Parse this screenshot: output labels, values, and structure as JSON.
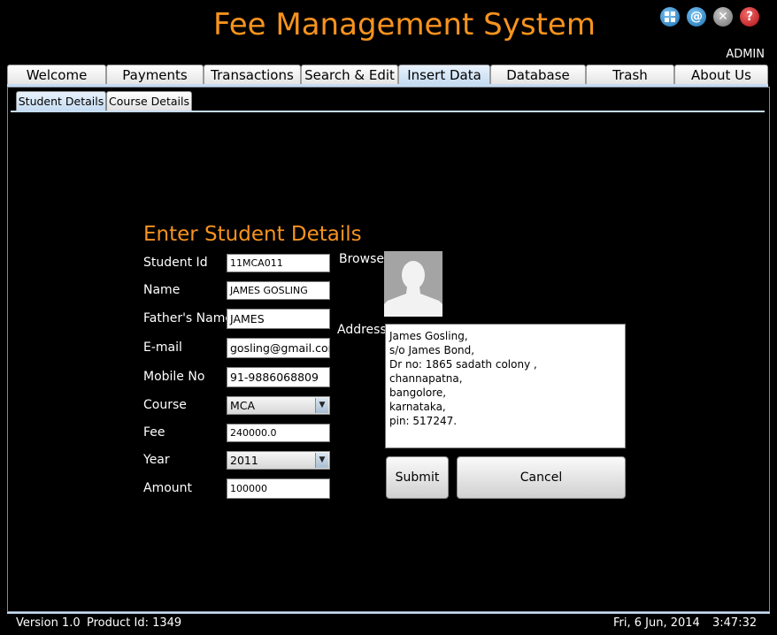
{
  "app": {
    "title": "Fee Management System",
    "user": "ADMIN",
    "icons": [
      "grid-icon",
      "at-icon",
      "close-icon",
      "help-icon"
    ],
    "icon_colors": {
      "grid": "#2e8fd1",
      "at": "#2e8fd1",
      "close": "#8c8c8c",
      "help": "#d0141a"
    },
    "accent": "#f7931e"
  },
  "tabs": [
    {
      "label": "Welcome"
    },
    {
      "label": "Payments"
    },
    {
      "label": "Transactions"
    },
    {
      "label": "Search & Edit"
    },
    {
      "label": "Insert Data",
      "active": true
    },
    {
      "label": "Database"
    },
    {
      "label": "Trash"
    },
    {
      "label": "About Us"
    }
  ],
  "subtabs": [
    {
      "label": "Student Details",
      "active": true
    },
    {
      "label": "Course Details"
    }
  ],
  "form": {
    "title": "Enter Student Details",
    "student_id": {
      "label": "Student Id",
      "value": "11MCA011"
    },
    "name": {
      "label": "Name",
      "value": "JAMES GOSLING"
    },
    "father": {
      "label": "Father's Name",
      "value": "JAMES"
    },
    "email": {
      "label": "E-mail",
      "value": "gosling@gmail.com"
    },
    "mobile": {
      "label": "Mobile No",
      "value": "91-9886068809"
    },
    "course": {
      "label": "Course",
      "value": "MCA"
    },
    "fee": {
      "label": "Fee",
      "value": "240000.0"
    },
    "year": {
      "label": "Year",
      "value": "2011"
    },
    "amount": {
      "label": "Amount",
      "value": "100000"
    },
    "browse_label": "Browse",
    "address_label": "Address",
    "address_value": "James Gosling,\ns/o James Bond,\nDr no: 1865 sadath colony ,\nchannapatna,\nbangolore,\nkarnataka,\npin: 517247.",
    "submit": "Submit",
    "cancel": "Cancel"
  },
  "status": {
    "version": "Version 1.0",
    "product": "Product Id: 1349",
    "date": "Fri, 6 Jun, 2014",
    "time": "3:47:32"
  }
}
